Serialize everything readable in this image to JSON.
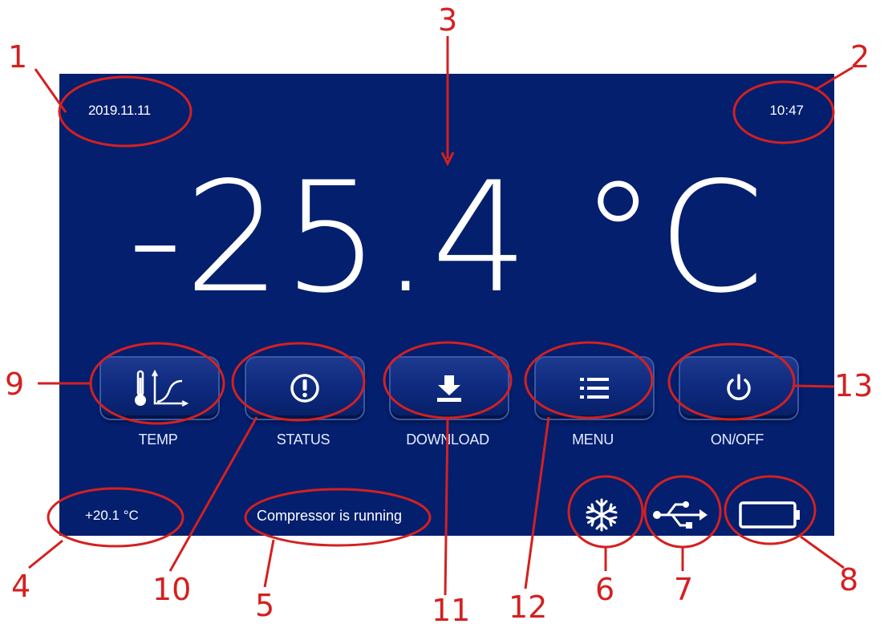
{
  "header": {
    "date": "2019.11.11",
    "time": "10:47"
  },
  "main": {
    "temperature": "-25.4 °C"
  },
  "buttons": [
    {
      "label": "TEMP",
      "icon": "thermometer-graph-icon"
    },
    {
      "label": "STATUS",
      "icon": "alert-icon"
    },
    {
      "label": "DOWNLOAD",
      "icon": "download-icon"
    },
    {
      "label": "MENU",
      "icon": "list-menu-icon"
    },
    {
      "label": "ON/OFF",
      "icon": "power-icon"
    }
  ],
  "footer": {
    "ambient_temperature": "+20.1 °C",
    "status_message": "Compressor is running",
    "icons": [
      "snowflake-icon",
      "usb-icon",
      "battery-icon"
    ]
  },
  "callouts": [
    "1",
    "2",
    "3",
    "4",
    "5",
    "6",
    "7",
    "8",
    "9",
    "10",
    "11",
    "12",
    "13"
  ],
  "colors": {
    "screen_bg": "#031f6e",
    "annotation": "#d42020",
    "text": "#ffffff"
  }
}
